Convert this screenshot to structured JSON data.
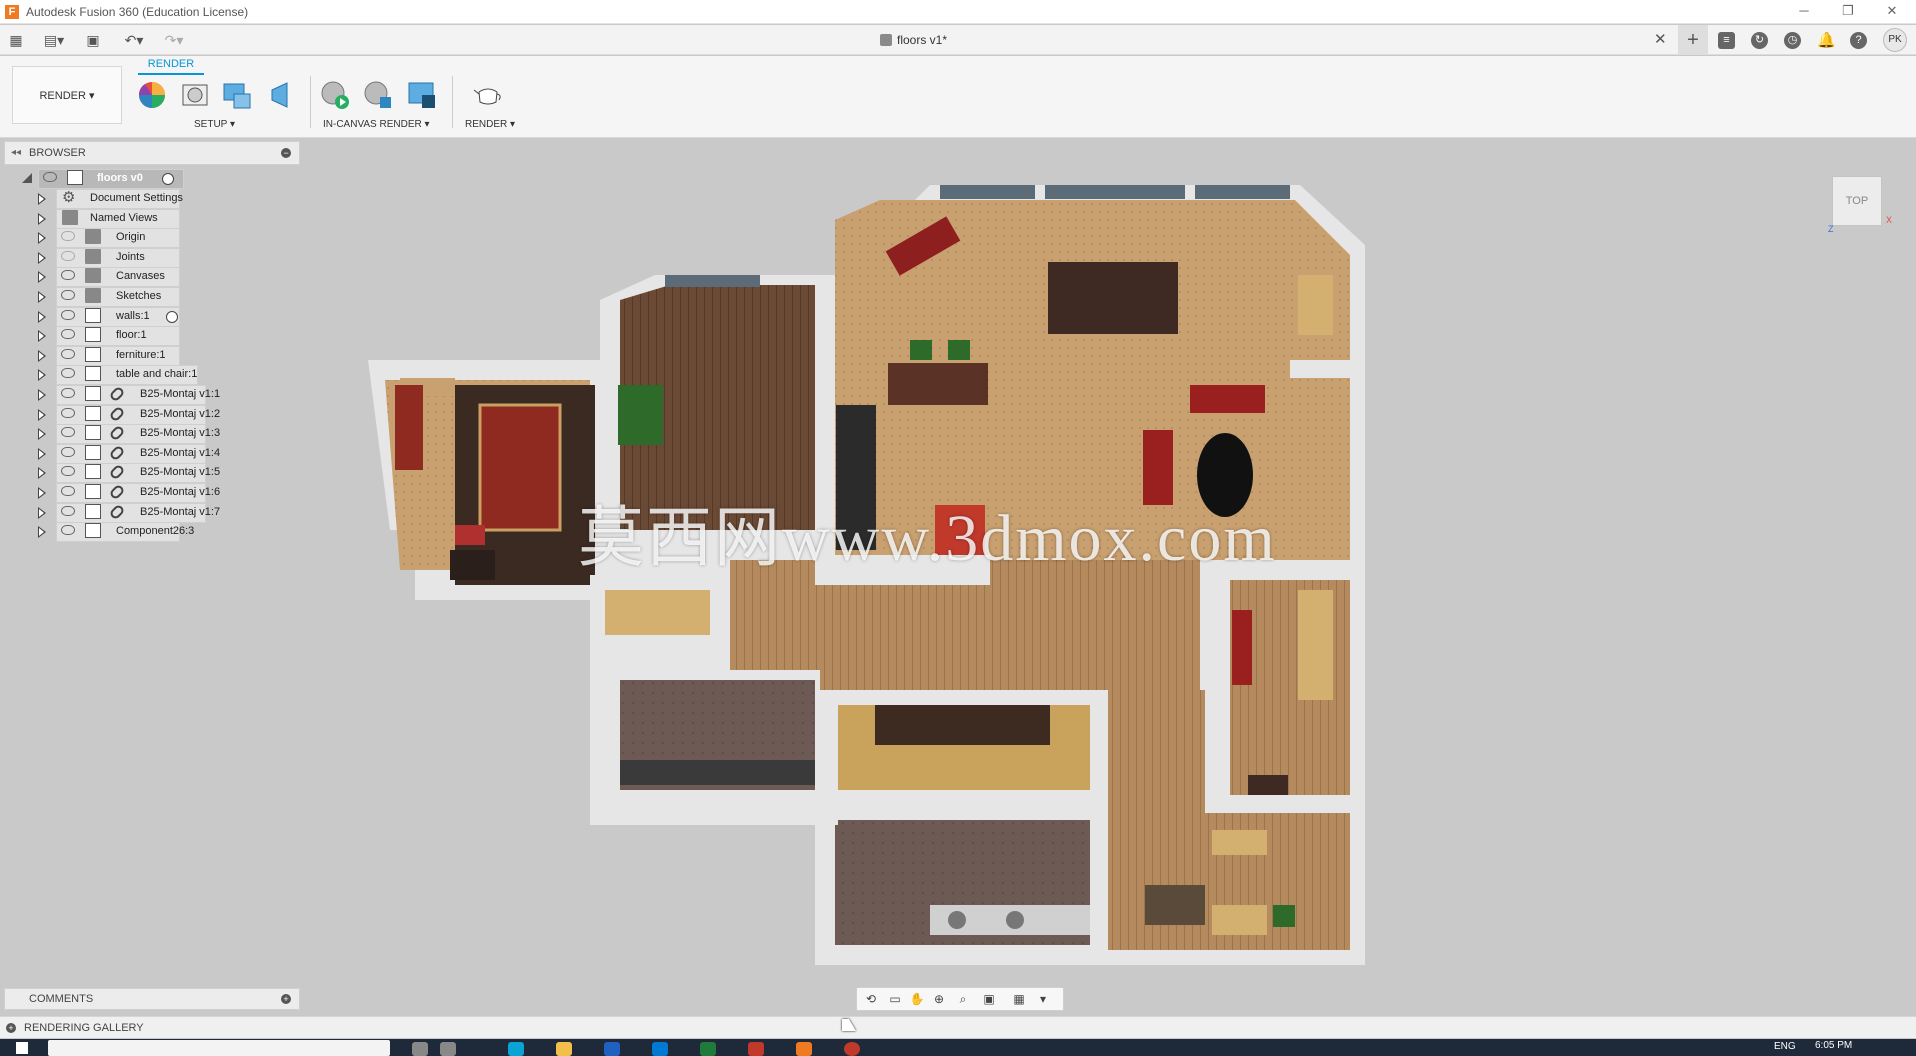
{
  "window": {
    "title": "Autodesk Fusion 360 (Education License)",
    "logo_letter": "F"
  },
  "document": {
    "tab_title": "floors v1*"
  },
  "user": {
    "initials": "PK"
  },
  "ribbon": {
    "active_tab": "RENDER",
    "workspace_button": "RENDER ▾",
    "groups": [
      {
        "label": "SETUP ▾"
      },
      {
        "label": "IN-CANVAS RENDER ▾"
      },
      {
        "label": "RENDER ▾"
      }
    ]
  },
  "browser": {
    "title": "BROWSER",
    "root": "floors v0",
    "items": [
      {
        "label": "Document Settings",
        "icon": "gear-icon"
      },
      {
        "label": "Named Views",
        "icon": "folder-icon"
      },
      {
        "label": "Origin",
        "icon": "folder-icon"
      },
      {
        "label": "Joints",
        "icon": "folder-icon"
      },
      {
        "label": "Canvases",
        "icon": "folder-icon"
      },
      {
        "label": "Sketches",
        "icon": "folder-icon"
      },
      {
        "label": "walls:1",
        "icon": "component-icon"
      },
      {
        "label": "floor:1",
        "icon": "component-icon"
      },
      {
        "label": "ferniture:1",
        "icon": "component-icon"
      },
      {
        "label": "table and chair:1",
        "icon": "component-icon"
      },
      {
        "label": "B25-Montaj v1:1",
        "icon": "linked-component-icon"
      },
      {
        "label": "B25-Montaj v1:2",
        "icon": "linked-component-icon"
      },
      {
        "label": "B25-Montaj v1:3",
        "icon": "linked-component-icon"
      },
      {
        "label": "B25-Montaj v1:4",
        "icon": "linked-component-icon"
      },
      {
        "label": "B25-Montaj v1:5",
        "icon": "linked-component-icon"
      },
      {
        "label": "B25-Montaj v1:6",
        "icon": "linked-component-icon"
      },
      {
        "label": "B25-Montaj v1:7",
        "icon": "linked-component-icon"
      },
      {
        "label": "Component26:3",
        "icon": "component-icon"
      }
    ]
  },
  "comments": {
    "title": "COMMENTS"
  },
  "gallery": {
    "title": "RENDERING GALLERY"
  },
  "viewcube": {
    "face": "TOP"
  },
  "watermark": {
    "text": "莫西网www.3dmox.com"
  },
  "taskbar": {
    "lang": "ENG",
    "time": "6:05 PM"
  },
  "colors": {
    "accent": "#0696d7",
    "background": "#c9c9c9"
  }
}
